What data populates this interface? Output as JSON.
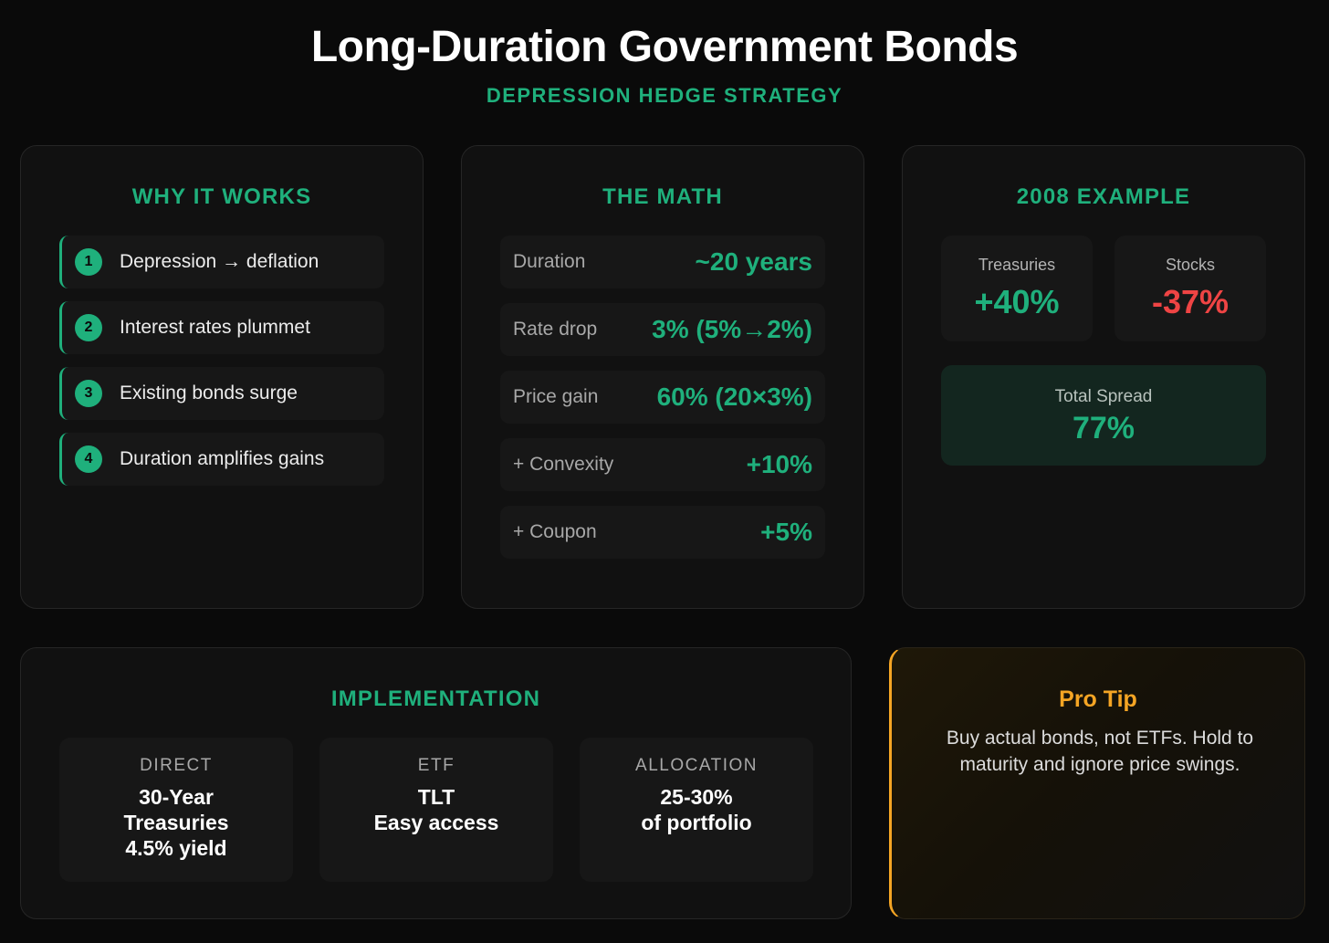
{
  "header": {
    "title": "Long-Duration Government Bonds",
    "subtitle": "DEPRESSION HEDGE STRATEGY"
  },
  "why": {
    "title": "WHY IT WORKS",
    "items": [
      {
        "num": "1",
        "text": "Depression → deflation"
      },
      {
        "num": "2",
        "text": "Interest rates plummet"
      },
      {
        "num": "3",
        "text": "Existing bonds surge"
      },
      {
        "num": "4",
        "text": "Duration amplifies gains"
      }
    ]
  },
  "math": {
    "title": "THE MATH",
    "rows": [
      {
        "label": "Duration",
        "value": "~20 years"
      },
      {
        "label": "Rate drop",
        "value": "3% (5%→2%)"
      },
      {
        "label": "Price gain",
        "value": "60% (20×3%)"
      },
      {
        "label": "+ Convexity",
        "value": "+10%"
      },
      {
        "label": "+ Coupon",
        "value": "+5%"
      }
    ]
  },
  "example": {
    "title": "2008 EXAMPLE",
    "treasuries_label": "Treasuries",
    "treasuries_value": "+40%",
    "stocks_label": "Stocks",
    "stocks_value": "-37%",
    "spread_label": "Total Spread",
    "spread_value": "77%"
  },
  "implementation": {
    "title": "IMPLEMENTATION",
    "direct": {
      "label": "DIRECT",
      "line1": "30-Year",
      "line2": "Treasuries",
      "line3": "4.5% yield"
    },
    "etf": {
      "label": "ETF",
      "line1": "TLT",
      "line2": "Easy access"
    },
    "allocation": {
      "label": "ALLOCATION",
      "line1": "25-30%",
      "line2": "of portfolio"
    }
  },
  "tip": {
    "title": "Pro Tip",
    "text": "Buy actual bonds, not ETFs. Hold to maturity and ignore price swings."
  },
  "colors": {
    "accent": "#1fb07c",
    "negative": "#ef4444",
    "tip_accent": "#f5a524",
    "background": "#0a0a0a"
  }
}
